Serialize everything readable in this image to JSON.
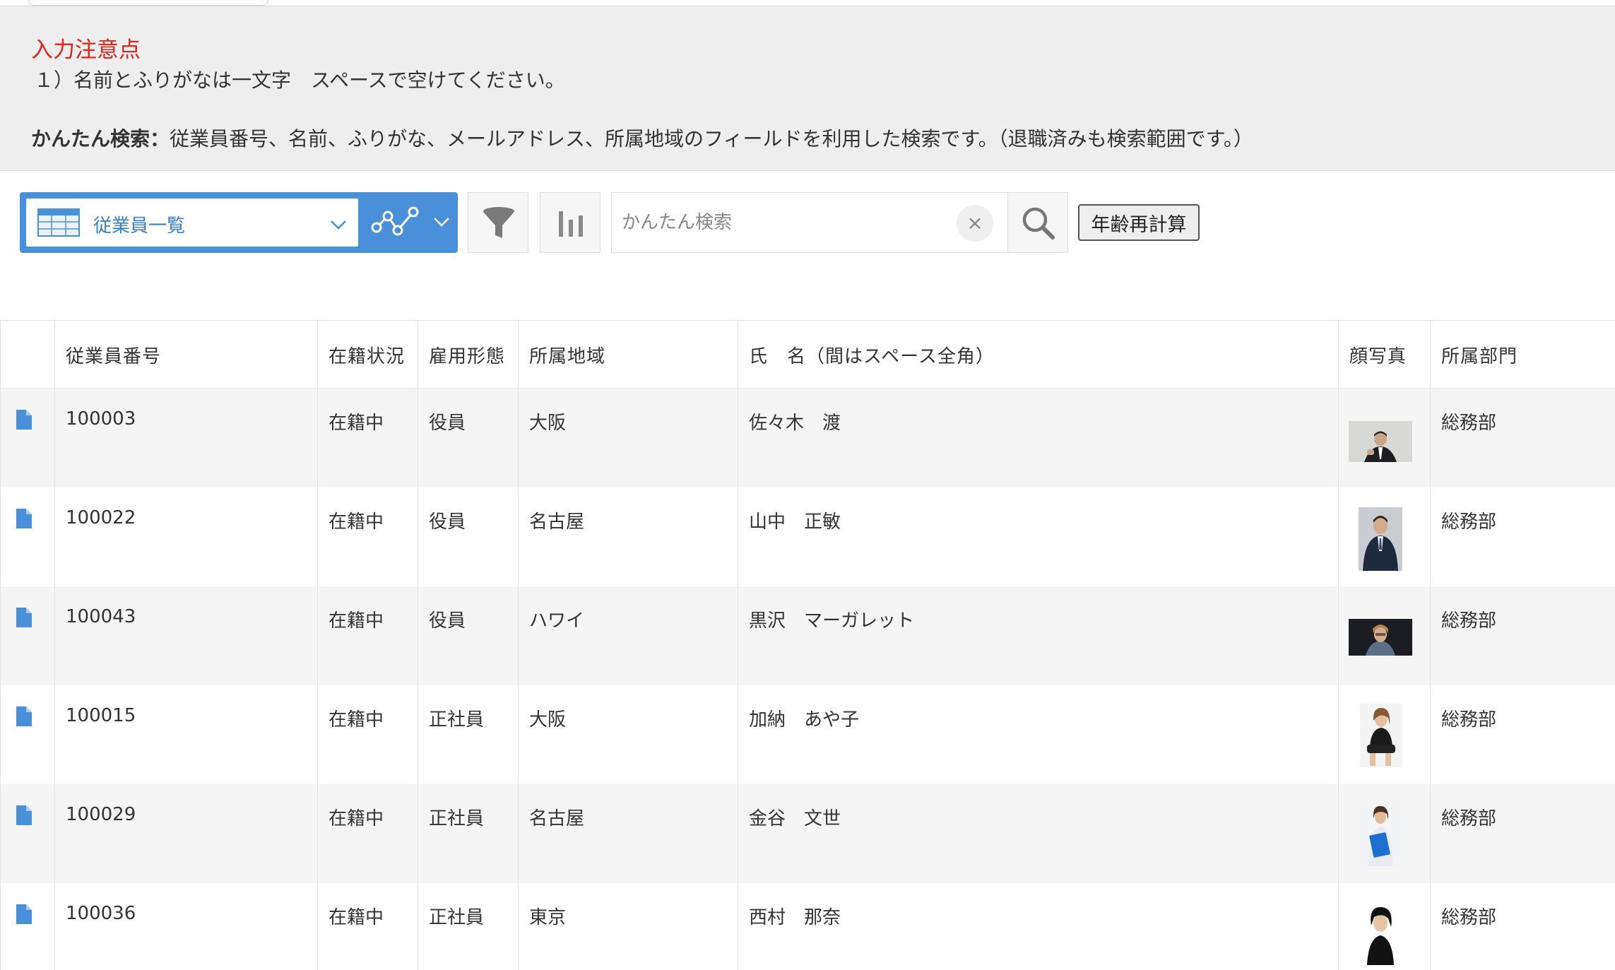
{
  "notice": {
    "title": "入力注意点",
    "line1": "１）名前とふりがなは一文字　スペースで空けてください。",
    "line2_bold": "かんたん検索：",
    "line2_rest": "従業員番号、名前、ふりがな、メールアドレス、所属地域のフィールドを利用した検索です。（退職済みも検索範囲です。）"
  },
  "toolbar": {
    "view_label": "従業員一覧",
    "search_placeholder": "かんたん検索",
    "clear_glyph": "×",
    "recalc_label": "年齢再計算"
  },
  "table": {
    "headers": [
      "従業員番号",
      "在籍状況",
      "雇用形態",
      "所属地域",
      "氏　名（間はスペース全角）",
      "顔写真",
      "所属部門"
    ],
    "rows": [
      {
        "id": "100003",
        "status": "在籍中",
        "type": "役員",
        "region": "大阪",
        "name": "佐々木　渡",
        "dept": "総務部",
        "photo": "man-suit-gray-bg"
      },
      {
        "id": "100022",
        "status": "在籍中",
        "type": "役員",
        "region": "名古屋",
        "name": "山中　正敏",
        "dept": "総務部",
        "photo": "man-suit-portrait"
      },
      {
        "id": "100043",
        "status": "在籍中",
        "type": "役員",
        "region": "ハワイ",
        "name": "黒沢　マーガレット",
        "dept": "総務部",
        "photo": "person-dark-bg"
      },
      {
        "id": "100015",
        "status": "在籍中",
        "type": "正社員",
        "region": "大阪",
        "name": "加納　あや子",
        "dept": "総務部",
        "photo": "woman-sitting"
      },
      {
        "id": "100029",
        "status": "在籍中",
        "type": "正社員",
        "region": "名古屋",
        "name": "金谷　文世",
        "dept": "総務部",
        "photo": "woman-blue-folder"
      },
      {
        "id": "100036",
        "status": "在籍中",
        "type": "正社員",
        "region": "東京",
        "name": "西村　那奈",
        "dept": "総務部",
        "photo": "woman-short-hair"
      }
    ]
  },
  "colors": {
    "accent": "#4a90d9",
    "notice_title": "#e0231c",
    "notice_bg": "#eeeeee",
    "row_alt": "#f5f5f5"
  }
}
